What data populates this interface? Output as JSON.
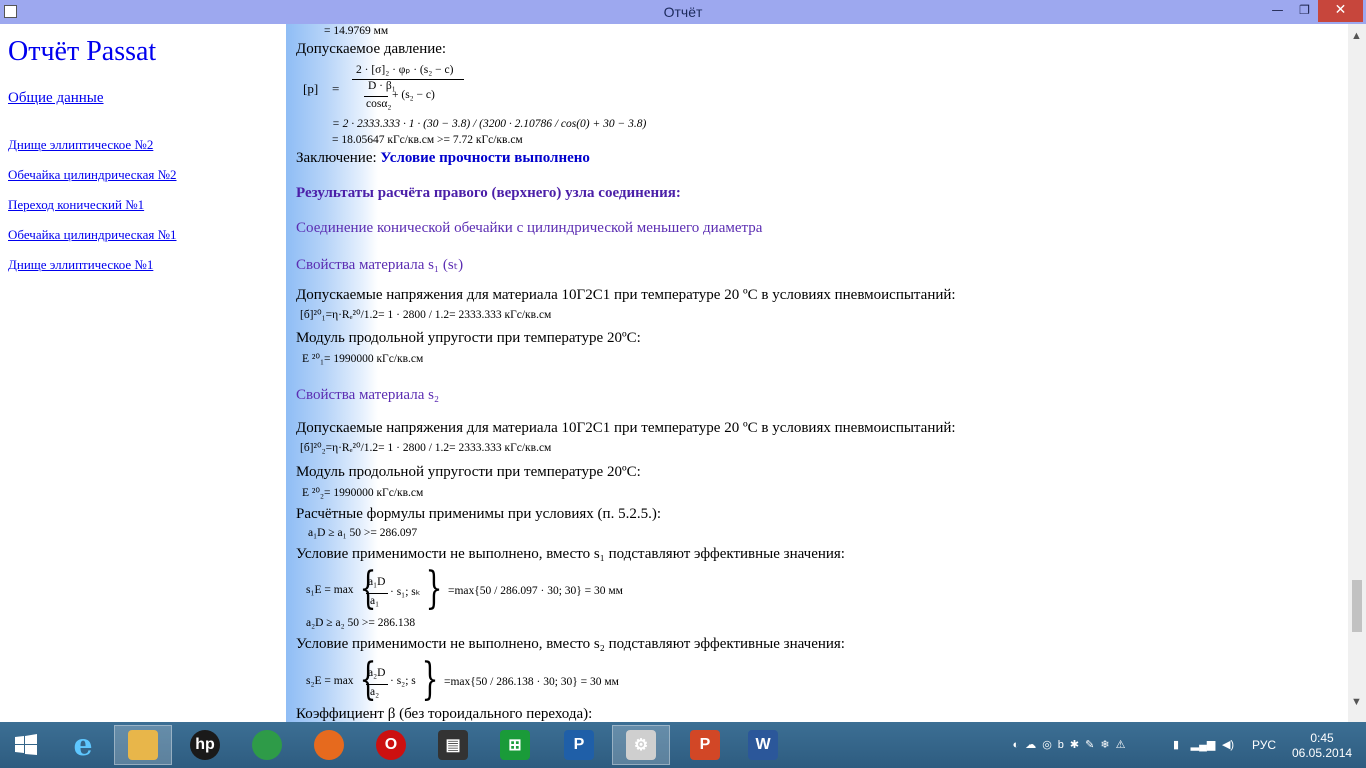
{
  "window": {
    "title": "Отчёт",
    "min": "—",
    "max": "❐",
    "close": "✕"
  },
  "sidebar": {
    "title": "Отчёт Passat",
    "general": "Общие данные",
    "items": [
      "Днище эллиптическое №2",
      "Обечайка цилиндрическая №2",
      "Переход конический №1",
      "Обечайка цилиндрическая №1",
      "Днище эллиптическое №1"
    ]
  },
  "report": {
    "l0": "=     14.9769 мм",
    "l1": "Допускаемое давление:",
    "p_label": "[p]",
    "eq": "=",
    "num_top": "2 · [σ]₂ · φₚ · (s₂ − c)",
    "den_top": "D · β₁",
    "den_bot": "cosα₂",
    "den_tail": "+ (s₂ − c)",
    "l2": "=     2 · 2333.333 · 1 · (30 − 3.8) / (3200 · 2.10786 / cos(0) + 30 − 3.8)",
    "l3": "=     18.05647 кГс/кв.см >= 7.72 кГс/кв.см",
    "concl_label": "Заключение:",
    "concl_value": "Условие прочности выполнено",
    "h1": "Результаты расчёта правого (верхнего) узла соединения:",
    "h2": "Соединение конической обечайки с цилиндрической меньшего диаметра",
    "h3": "Свойства материала s₁ (sₜ)",
    "allow1": "Допускаемые напряжения для материала 10Г2С1 при температуре 20 ºС в условиях пневмоиспытаний:",
    "sig1": "[б]²⁰₁=η·Rₑ²⁰/1.2=   1 · 2800 / 1.2=     2333.333 кГс/кв.см",
    "mod1": "Модуль продольной упругости при температуре 20ºС:",
    "e1": "E ²⁰₁=     1990000 кГс/кв.см",
    "h4": "Свойства материала s₂",
    "allow2": "Допускаемые напряжения для материала 10Г2С1 при температуре 20 ºС в условиях пневмоиспытаний:",
    "sig2": "[б]²⁰₂=η·Rₑ²⁰/1.2=   1 · 2800 / 1.2=     2333.333 кГс/кв.см",
    "mod2": "Модуль продольной упругости при температуре 20ºС:",
    "e2": "E ²⁰₂=     1990000 кГс/кв.см",
    "cond": "Расчётные формулы применимы при условиях (п. 5.2.5.):",
    "c1": "a₁D ≥ a₁       50 >= 286.097",
    "notok1": "Условие применимости не выполнено, вместо s₁ подставляют эффективные значения:",
    "s1e_lhs": "s₁E = max",
    "s1e_num": "a₁D",
    "s1e_den": "a₁",
    "s1e_tail": "· s₁; sₖ",
    "s1e_res": "=max{50 / 286.097 · 30; 30} = 30 мм",
    "c2": "a₂D ≥ a₂       50 >= 286.138",
    "notok2": "Условие применимости не выполнено, вместо s₂ подставляют эффективные значения:",
    "s2e_lhs": "s₂E = max",
    "s2e_num": "a₂D",
    "s2e_den": "a₂",
    "s2e_tail": "· s₂; s",
    "s2e_res": "=max{50 / 286.138 · 30; 30} = 30 мм",
    "beta": "Коэффициент β (без тороидального перехода):"
  },
  "taskbar": {
    "apps": [
      {
        "icon": "folder-icon",
        "label": "",
        "color": "#e8b64a"
      },
      {
        "icon": "hp-icon",
        "label": "hp",
        "color": "#1a1a1a"
      },
      {
        "icon": "chrome-icon",
        "label": "",
        "color": "#2e9b48"
      },
      {
        "icon": "firefox-icon",
        "label": "",
        "color": "#e66a1e"
      },
      {
        "icon": "opera-icon",
        "label": "O",
        "color": "#cc1010"
      },
      {
        "icon": "app-icon",
        "label": "▤",
        "color": "#333333"
      },
      {
        "icon": "store-icon",
        "label": "⊞",
        "color": "#1a9b39"
      },
      {
        "icon": "passat-icon",
        "label": "P",
        "color": "#1f5fa8"
      },
      {
        "icon": "passat-report-icon",
        "label": "⚙",
        "color": "#cfcfcf"
      },
      {
        "icon": "powerpoint-icon",
        "label": "P",
        "color": "#d24726"
      },
      {
        "icon": "word-icon",
        "label": "W",
        "color": "#2b579a"
      }
    ],
    "tray": [
      "◐",
      "☁",
      "◎",
      "b",
      "✱",
      "✎",
      "❄",
      "⚠",
      "▮",
      "▂▄▆",
      "◀)"
    ],
    "lang": "РУС",
    "time": "0:45",
    "date": "06.05.2014"
  }
}
